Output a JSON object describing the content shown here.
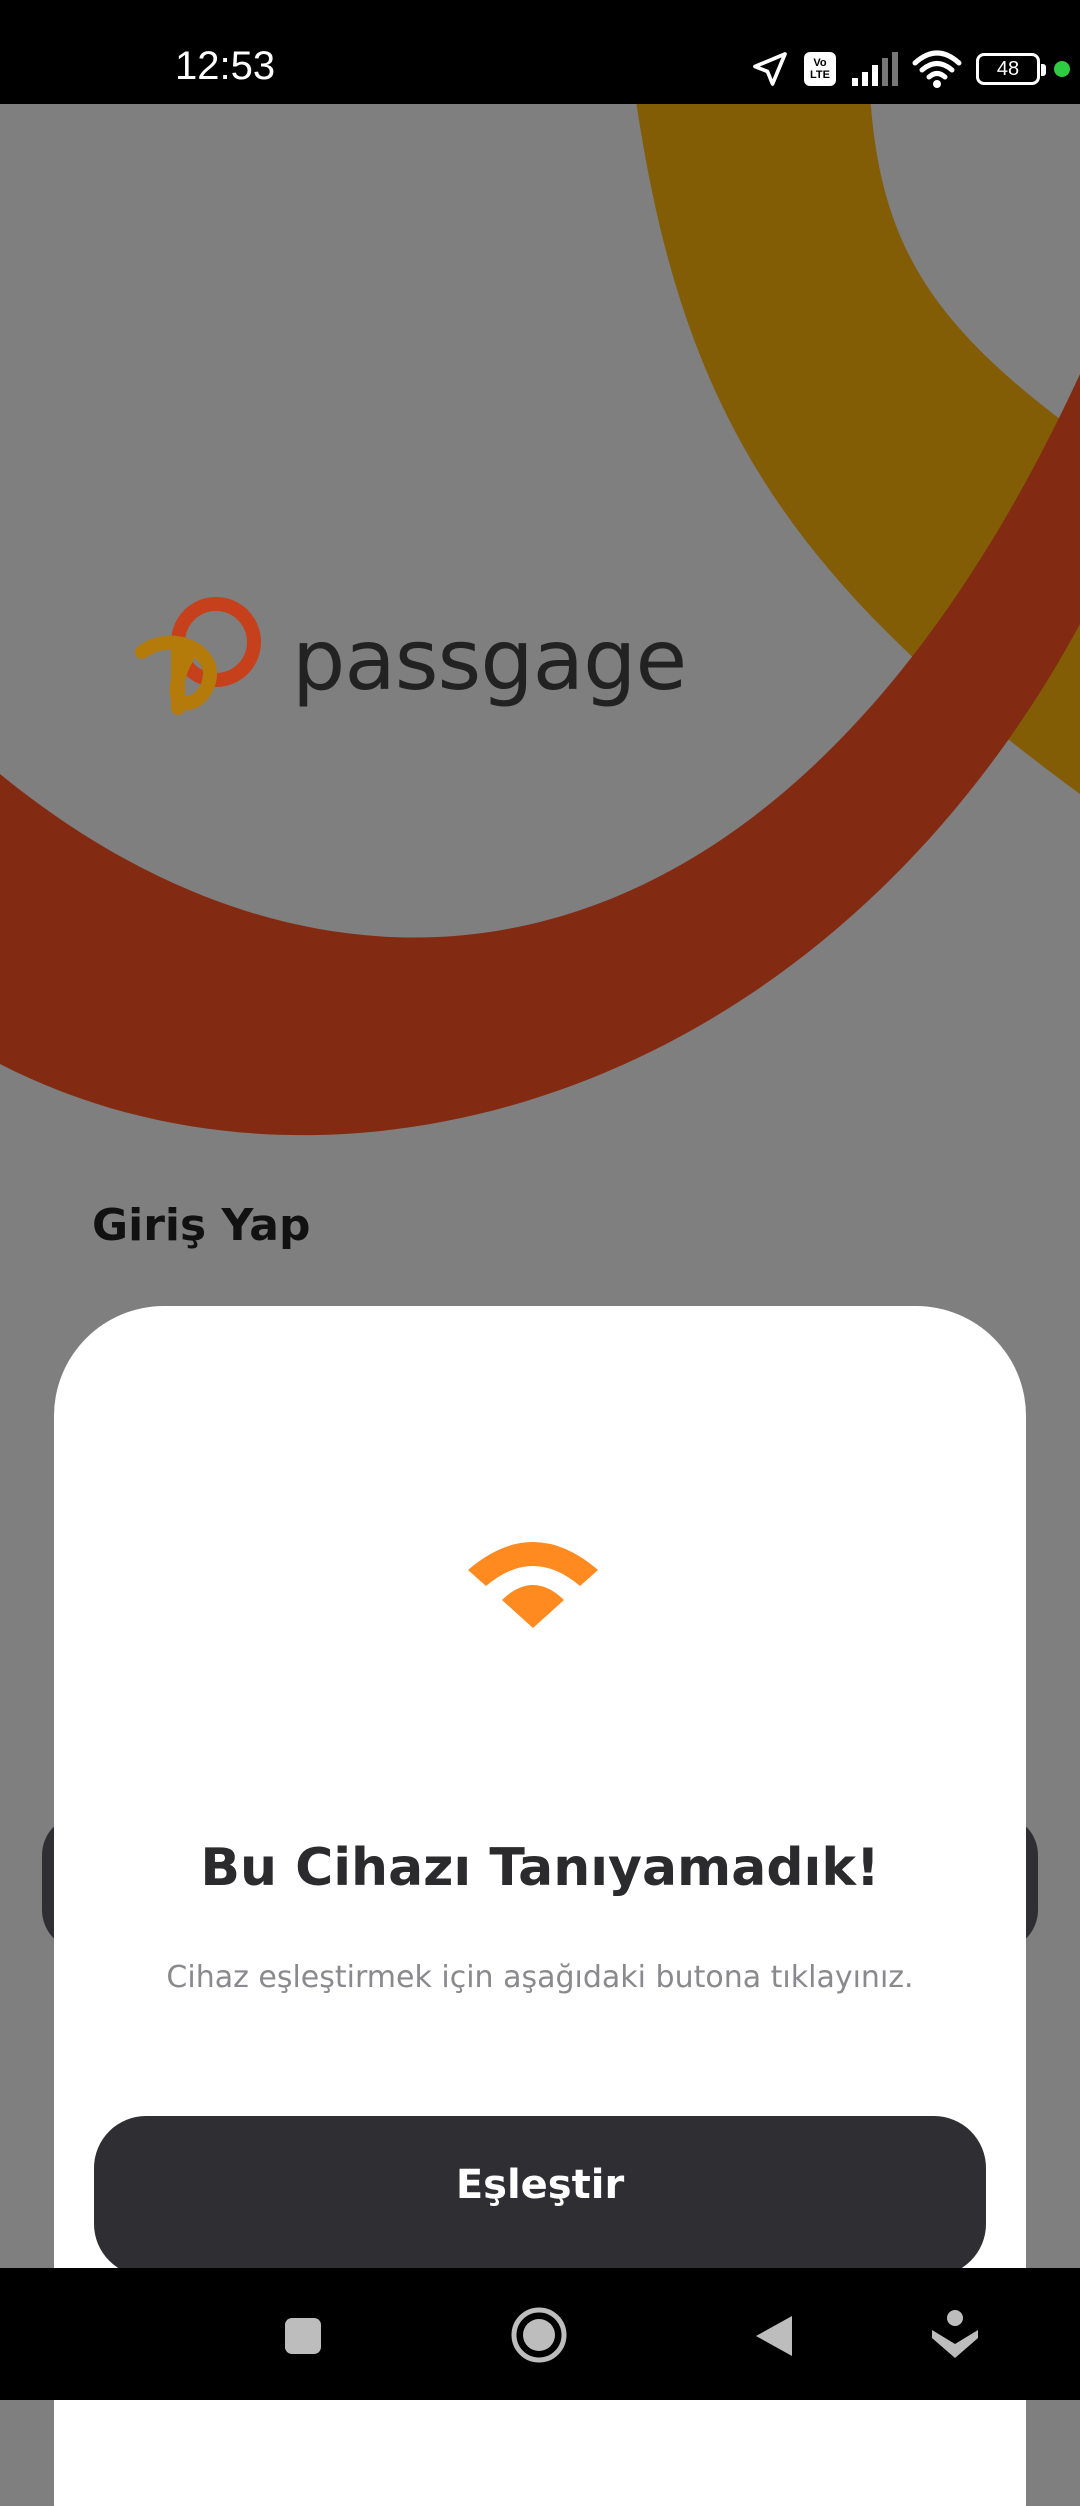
{
  "status_bar": {
    "time": "12:53",
    "volte_top": "Vo",
    "volte_bottom": "LTE",
    "battery": "48",
    "icons": [
      "location-arrow-icon",
      "volte-icon",
      "signal-icon",
      "wifi-icon",
      "battery-icon",
      "active-dot-icon"
    ]
  },
  "brand": {
    "logo_text": "passgage",
    "colors": {
      "primary_red": "#832a12",
      "mustard": "#835c06",
      "accent_orange": "#ff8a1f",
      "dark_button": "#2f2f33"
    }
  },
  "login": {
    "title": "Giriş Yap"
  },
  "modal": {
    "icon": "wifi-icon",
    "title": "Bu Cihazı Tanıyamadık!",
    "subtitle": "Cihaz eşleştirmek için aşağıdaki butona tıklayınız.",
    "pair_button_label": "Eşleştir"
  },
  "nav_bar": {
    "buttons": [
      "recents-square-icon",
      "home-circle-icon",
      "back-triangle-icon",
      "assistant-icon"
    ]
  }
}
